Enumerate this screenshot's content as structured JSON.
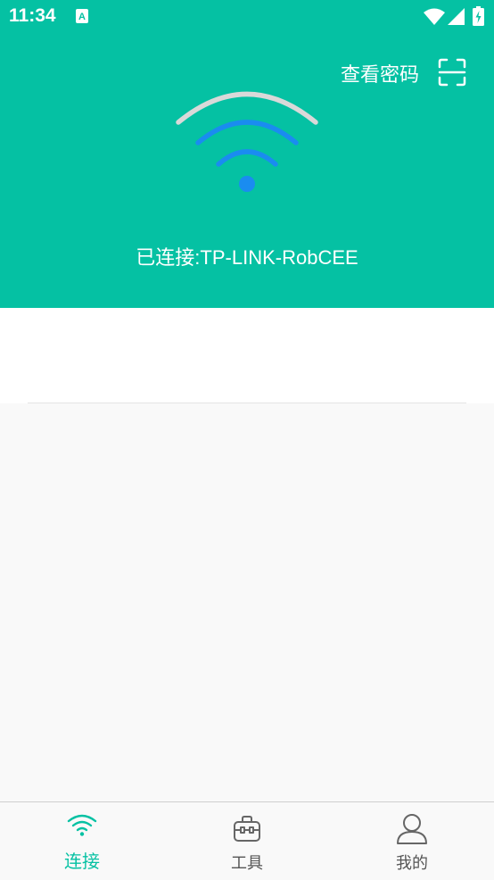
{
  "status_bar": {
    "time": "11:34",
    "icons": [
      "app-notification-icon",
      "wifi-icon",
      "signal-icon",
      "battery-icon"
    ]
  },
  "header": {
    "view_password_label": "查看密码",
    "scan_icon": "scan-icon",
    "connected_text": "已连接:TP-LINK-RobCEE",
    "background_color": "#05c1a3",
    "wifi_arc_outer_color": "#d9d9d9",
    "wifi_arc_inner_color": "#1a8cf0"
  },
  "bottom_nav": {
    "items": [
      {
        "label": "连接",
        "icon": "wifi-icon",
        "active": true
      },
      {
        "label": "工具",
        "icon": "toolbox-icon",
        "active": false
      },
      {
        "label": "我的",
        "icon": "user-icon",
        "active": false
      }
    ],
    "active_color": "#05c1a3"
  }
}
